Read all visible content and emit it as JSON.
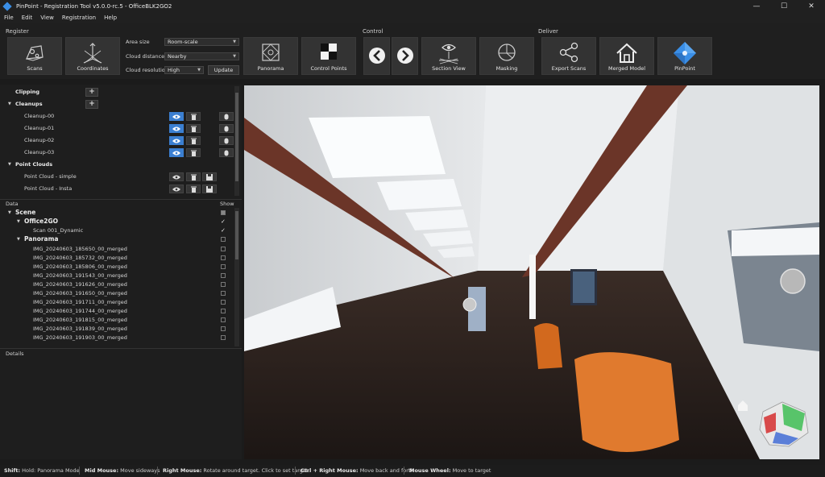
{
  "window": {
    "title": "PinPoint - Registration Tool v5.0.0-rc.5 - OfficeBLK2GO2",
    "controls": [
      "—",
      "☐",
      "✕"
    ]
  },
  "menu": [
    "File",
    "Edit",
    "View",
    "Registration",
    "Help"
  ],
  "ribbon": {
    "groups": {
      "register": "Register",
      "control": "Control",
      "deliver": "Deliver"
    },
    "scans": "Scans",
    "coordinates": "Coordinates",
    "area_size_label": "Area size",
    "area_size_value": "Room-scale",
    "cloud_distances_label": "Cloud distances",
    "cloud_distances_value": "Nearby",
    "cloud_resolution_label": "Cloud resolution",
    "cloud_resolution_value": "High",
    "update": "Update",
    "panorama": "Panorama",
    "control_points": "Control Points",
    "section_view": "Section View",
    "masking": "Masking",
    "export_scans": "Export Scans",
    "merged_model": "Merged Model",
    "pinpoint": "PinPoint"
  },
  "tools_tree": {
    "clipping": "Clipping",
    "cleanups": "Cleanups",
    "cleanup_items": [
      "Cleanup-00",
      "Cleanup-01",
      "Cleanup-02",
      "Cleanup-03"
    ],
    "point_clouds": "Point Clouds",
    "point_cloud_items": [
      "Point Cloud - simple",
      "Point Cloud - Insta"
    ]
  },
  "data_panel": {
    "header": "Data",
    "show_header": "Show",
    "scene": "Scene",
    "office": "Office2GO",
    "scan": "Scan 001_Dynamic",
    "panorama": "Panorama",
    "images": [
      "IMG_20240603_185650_00_merged",
      "IMG_20240603_185732_00_merged",
      "IMG_20240603_185806_00_merged",
      "IMG_20240603_191543_00_merged",
      "IMG_20240603_191626_00_merged",
      "IMG_20240603_191650_00_merged",
      "IMG_20240603_191711_00_merged",
      "IMG_20240603_191744_00_merged",
      "IMG_20240603_191815_00_merged",
      "IMG_20240603_191839_00_merged",
      "IMG_20240603_191903_00_merged"
    ]
  },
  "details": "Details",
  "statusbar": [
    {
      "key": "Shift:",
      "text": "Hold: Panorama Mode"
    },
    {
      "key": "Mid Mouse:",
      "text": "Move sideways"
    },
    {
      "key": "Right Mouse:",
      "text": "Rotate around target. Click to set target."
    },
    {
      "key": "Ctrl + Right Mouse:",
      "text": "Move back and forth"
    },
    {
      "key": "Mouse Wheel:",
      "text": "Move to target"
    }
  ]
}
